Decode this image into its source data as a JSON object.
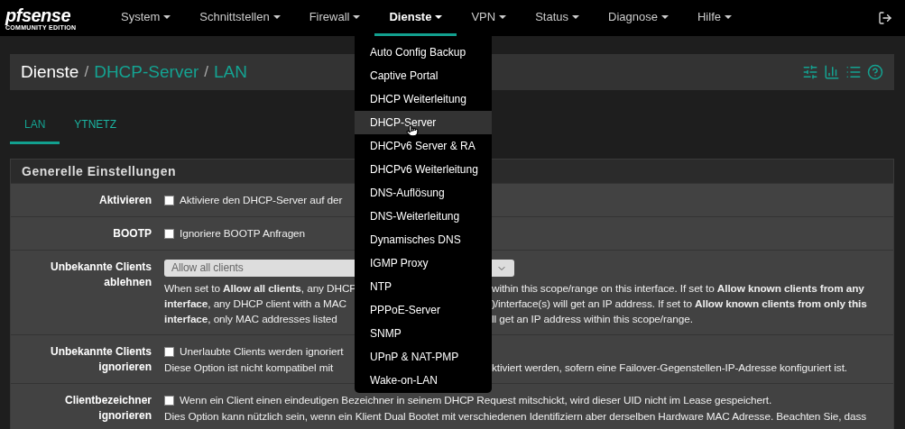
{
  "brand": {
    "logo": "pfsense",
    "edition": "COMMUNITY EDITION"
  },
  "nav": [
    {
      "label": "System",
      "selected": false
    },
    {
      "label": "Schnittstellen",
      "selected": false
    },
    {
      "label": "Firewall",
      "selected": false
    },
    {
      "label": "Dienste",
      "selected": true
    },
    {
      "label": "VPN",
      "selected": false
    },
    {
      "label": "Status",
      "selected": false
    },
    {
      "label": "Diagnose",
      "selected": false
    },
    {
      "label": "Hilfe",
      "selected": false
    }
  ],
  "breadcrumb": [
    {
      "label": "Dienste",
      "separator": "/"
    },
    {
      "label": "DHCP-Server",
      "separator": "/"
    },
    {
      "label": "LAN"
    }
  ],
  "tabs": [
    {
      "label": "LAN",
      "selected": true
    },
    {
      "label": "YTNETZ",
      "selected": false
    }
  ],
  "panel": {
    "title": "Generelle Einstellungen",
    "rows": [
      {
        "label": "Aktivieren",
        "kind": "checkbox",
        "checked": false,
        "text": {
          "left": "Aktiviere den DHCP-Server auf der"
        }
      },
      {
        "label": "BOOTP",
        "kind": "checkbox",
        "checked": false,
        "text": {
          "left": "Ignoriere BOOTP Anfragen"
        }
      },
      {
        "label": "Unbekannte Clients ablehnen",
        "kind": "select",
        "value": "Allow all clients",
        "help": [
          {
            "left": "When set to **Allow all clients**, any DHCP",
            "right": "within this scope/range on this interface. If set to **Allow known clients from any**"
          },
          {
            "left": "**interface**, any DHCP client with a MAC",
            "right": ")/interface(s) will get an IP address. If set to **Allow known clients from only this**"
          },
          {
            "left": "**interface**, only MAC addresses listed",
            "right": "ll get an IP address within this scope/range."
          }
        ]
      },
      {
        "label": "Unbekannte Clients ignorieren",
        "kind": "checkbox",
        "checked": false,
        "text": {
          "left": "Unerlaubte Clients werden ignoriert"
        },
        "help": [
          {
            "left": "Diese Option ist nicht kompatibel mit",
            "right": "ktiviert werden, sofern eine Failover-Gegenstellen-IP-Adresse konfiguriert ist."
          }
        ]
      },
      {
        "label": "Clientbezeichner ignorieren",
        "kind": "checkbox",
        "checked": false,
        "text": {
          "left": "Wenn ein Client einen eindeutigen Bezeichner in seinem DHCP Request mitschickt, wird dieser UID nicht im Lease gespeichert."
        },
        "help": [
          {
            "left": "Dies Option kann nützlich sein, wenn ein Klient Dual Bootet mit verschiedenen Identifiziern aber derselben Hardware MAC Adresse. Beachten Sie, dass"
          }
        ]
      }
    ]
  },
  "menu": [
    {
      "label": "Auto Config Backup",
      "selected": false
    },
    {
      "label": "Captive Portal",
      "selected": false
    },
    {
      "label": "DHCP Weiterleitung",
      "selected": false
    },
    {
      "label": "DHCP-Server",
      "selected": true
    },
    {
      "label": "DHCPv6 Server & RA",
      "selected": false
    },
    {
      "label": "DHCPv6 Weiterleitung",
      "selected": false
    },
    {
      "label": "DNS-Auflösung",
      "selected": false
    },
    {
      "label": "DNS-Weiterleitung",
      "selected": false
    },
    {
      "label": "Dynamisches DNS",
      "selected": false
    },
    {
      "label": "IGMP Proxy",
      "selected": false
    },
    {
      "label": "NTP",
      "selected": false
    },
    {
      "label": "PPPoE-Server",
      "selected": false
    },
    {
      "label": "SNMP",
      "selected": false
    },
    {
      "label": "UPnP & NAT-PMP",
      "selected": false
    },
    {
      "label": "Wake-on-LAN",
      "selected": false
    }
  ]
}
